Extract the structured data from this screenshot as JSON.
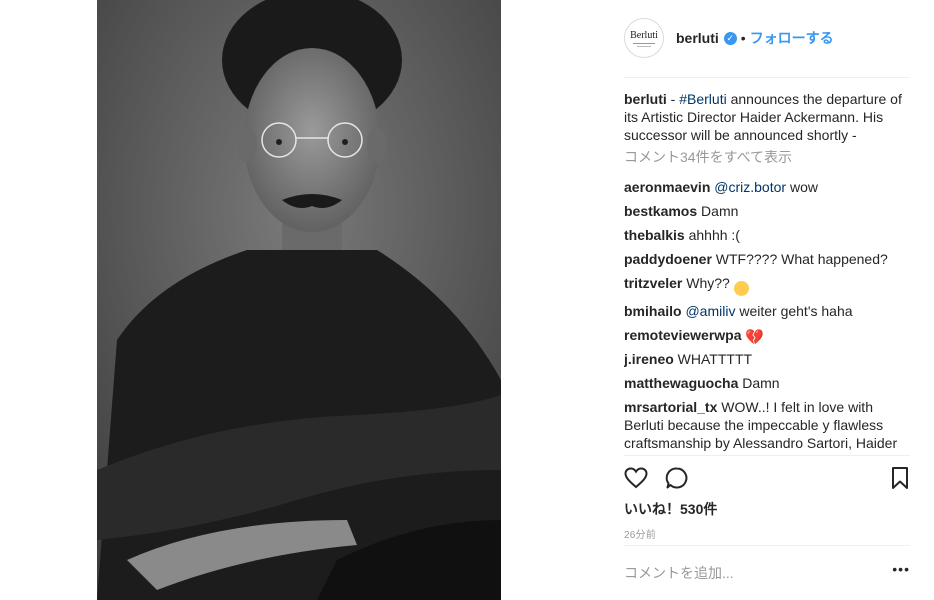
{
  "post": {
    "image_alt": "Black-and-white portrait of a man with curly hair, round glasses and a moustache, wearing a dark sweater, arms folded over a chair back"
  },
  "header": {
    "avatar_text": "Berluti",
    "username": "berluti",
    "verified_icon": "✓",
    "separator": "•",
    "follow_label": "フォローする"
  },
  "caption": {
    "username": "berluti",
    "pre": " - ",
    "hashtag": "#Berluti",
    "text": " announces the departure of its Artistic Director Haider Ackermann. His successor will be announced shortly -"
  },
  "view_all_comments": "コメント34件をすべて表示",
  "comments": [
    {
      "user": "aeronmaevin",
      "mention": "@criz.botor",
      "text": " wow"
    },
    {
      "user": "bestkamos",
      "text": " Damn"
    },
    {
      "user": "thebalkis",
      "text": " ahhhh :("
    },
    {
      "user": "paddydoener",
      "text": " WTF???? What happened?"
    },
    {
      "user": "tritzveler",
      "text": " Why?? ",
      "emoji": "😱"
    },
    {
      "user": "bmihailo",
      "mention": "@amiliv",
      "text": " weiter geht's haha"
    },
    {
      "user": "remoteviewerwpa",
      "text": " ",
      "emoji": "💔"
    },
    {
      "user": "j.ireneo",
      "text": " WHATTTTT"
    },
    {
      "user": "matthewaguocha",
      "text": " Damn"
    },
    {
      "user": "mrsartorial_tx",
      "text": " WOW..! I felt in love with Berluti because the impeccable y flawless craftsmanship by Alessandro Sartori, Haider was not a good fit for such a level of Italian"
    }
  ],
  "likes": "いいね！530件",
  "timestamp": "26分前",
  "add_comment_placeholder": "コメントを追加...",
  "more_options": "•••",
  "colors": {
    "link_blue": "#3897f0",
    "mention_blue": "#003569",
    "muted": "#999999"
  }
}
